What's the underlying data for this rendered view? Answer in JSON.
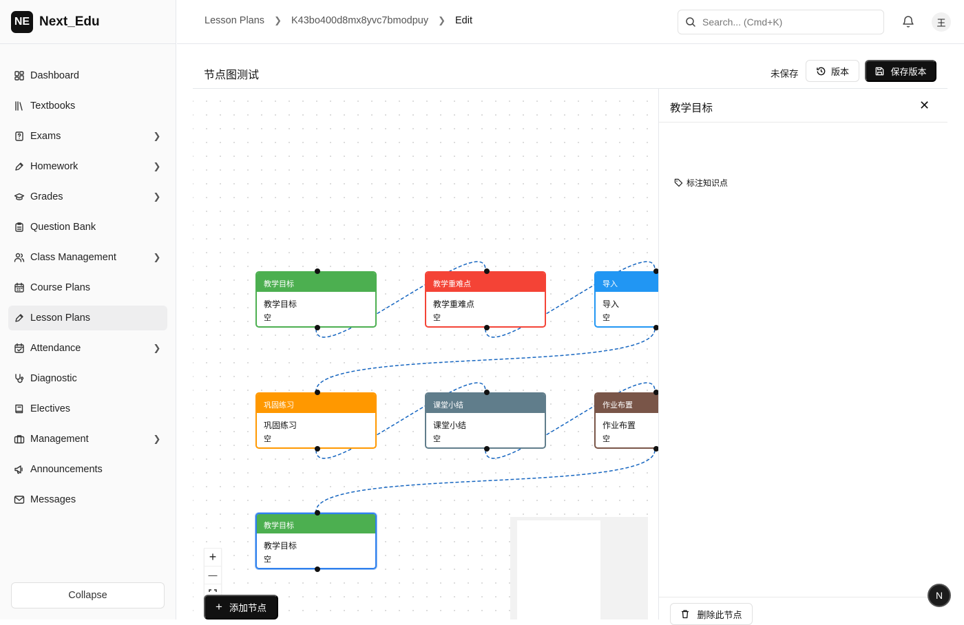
{
  "app": {
    "logo": "NE",
    "name": "Next_Edu"
  },
  "sidebar": {
    "items": [
      {
        "label": "Dashboard",
        "icon": "dashboard-icon",
        "chevron": false,
        "active": false
      },
      {
        "label": "Textbooks",
        "icon": "library-icon",
        "chevron": false,
        "active": false
      },
      {
        "label": "Exams",
        "icon": "exam-icon",
        "chevron": true,
        "active": false
      },
      {
        "label": "Homework",
        "icon": "pen-icon",
        "chevron": true,
        "active": false
      },
      {
        "label": "Grades",
        "icon": "graduation-cap-icon",
        "chevron": true,
        "active": false
      },
      {
        "label": "Question Bank",
        "icon": "clipboard-icon",
        "chevron": false,
        "active": false
      },
      {
        "label": "Class Management",
        "icon": "users-icon",
        "chevron": true,
        "active": false
      },
      {
        "label": "Course Plans",
        "icon": "calendar-icon",
        "chevron": false,
        "active": false
      },
      {
        "label": "Lesson Plans",
        "icon": "pen-icon",
        "chevron": false,
        "active": true
      },
      {
        "label": "Attendance",
        "icon": "calendar-check-icon",
        "chevron": true,
        "active": false
      },
      {
        "label": "Diagnostic",
        "icon": "stethoscope-icon",
        "chevron": false,
        "active": false
      },
      {
        "label": "Electives",
        "icon": "book-icon",
        "chevron": false,
        "active": false
      },
      {
        "label": "Management",
        "icon": "briefcase-icon",
        "chevron": true,
        "active": false
      },
      {
        "label": "Announcements",
        "icon": "megaphone-icon",
        "chevron": false,
        "active": false
      },
      {
        "label": "Messages",
        "icon": "mail-icon",
        "chevron": false,
        "active": false
      }
    ],
    "collapse_label": "Collapse"
  },
  "topbar": {
    "breadcrumbs": [
      "Lesson Plans",
      "K43bo400d8mx8yvc7bmodpuy",
      "Edit"
    ],
    "search_placeholder": "Search... (Cmd+K)",
    "avatar": "王"
  },
  "editor": {
    "title": "节点图测试",
    "status": "未保存",
    "version_label": "版本",
    "save_label": "保存版本",
    "add_node_label": "添加节点",
    "zoom_in": "+",
    "zoom_out": "—"
  },
  "nodes": [
    {
      "header": "教学目标",
      "title": "教学目标",
      "content": "空",
      "color": "#4caf50",
      "selected": false
    },
    {
      "header": "教学重难点",
      "title": "教学重难点",
      "content": "空",
      "color": "#f44336",
      "selected": false
    },
    {
      "header": "导入",
      "title": "导入",
      "content": "空",
      "color": "#2196f3",
      "selected": false
    },
    {
      "header": "巩固练习",
      "title": "巩固练习",
      "content": "空",
      "color": "#ff9800",
      "selected": false
    },
    {
      "header": "课堂小结",
      "title": "课堂小结",
      "content": "空",
      "color": "#607d8b",
      "selected": false
    },
    {
      "header": "作业布置",
      "title": "作业布置",
      "content": "空",
      "color": "#795548",
      "selected": false
    },
    {
      "header": "教学目标",
      "title": "教学目标",
      "content": "空",
      "color": "#4caf50",
      "selected": true
    }
  ],
  "edge_color": "#1565c0",
  "panel": {
    "title": "教学目标",
    "tag_label": "标注知识点",
    "delete_label": "删除此节点"
  },
  "fab_label": "N"
}
